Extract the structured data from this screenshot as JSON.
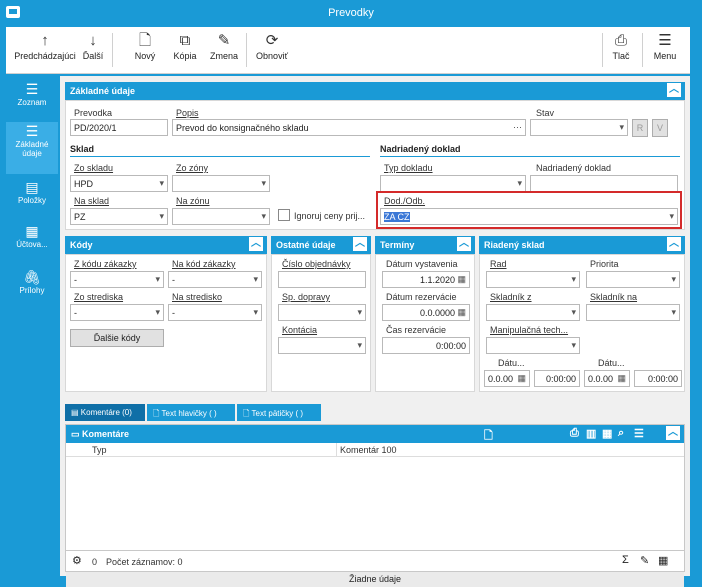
{
  "window": {
    "title": "Prevodky"
  },
  "ribbon": {
    "prev": "Predchádzajúci",
    "next": "Ďalší",
    "new": "Nový",
    "copy": "Kópia",
    "change": "Zmena",
    "refresh": "Obnoviť",
    "print": "Tlač",
    "menu": "Menu"
  },
  "sidebar": {
    "items": [
      {
        "label": "Zoznam"
      },
      {
        "label": "Základné údaje"
      },
      {
        "label": "Položky"
      },
      {
        "label": "Účtova..."
      },
      {
        "label": "Prílohy"
      }
    ]
  },
  "basic": {
    "header": "Základné údaje",
    "prevodka_label": "Prevodka",
    "prevodka_value": "PD/2020/1",
    "popis_label": "Popis",
    "popis_value": "Prevod do konsignačného skladu",
    "stav_label": "Stav",
    "stav_value": "",
    "r_btn": "R",
    "v_btn": "V"
  },
  "sklad": {
    "title": "Sklad",
    "zo_skladu_label": "Zo skladu",
    "zo_skladu_value": "HPD",
    "zo_zony_label": "Zo zóny",
    "zo_zony_value": "",
    "na_sklad_label": "Na sklad",
    "na_sklad_value": "PZ",
    "na_zonu_label": "Na zónu",
    "na_zonu_value": "",
    "ignoruj_label": "Ignoruj ceny prij..."
  },
  "nadriadeny": {
    "title": "Nadriadený doklad",
    "typ_label": "Typ dokladu",
    "typ_value": "",
    "doklad_label": "Nadriadený doklad",
    "doklad_value": "",
    "dod_label": "Dod./Odb.",
    "dod_value": "ZA CZ"
  },
  "kody": {
    "header": "Kódy",
    "z_kodu_label": "Z kódu zákazky",
    "z_kodu_value": "-",
    "na_kod_label": "Na kód zákazky",
    "na_kod_value": "-",
    "zo_strediska_label": "Zo strediska",
    "zo_strediska_value": "-",
    "na_stredisko_label": "Na stredisko",
    "na_stredisko_value": "-",
    "dalsie_btn": "Ďalšie kódy"
  },
  "ostatne": {
    "header": "Ostatné údaje",
    "cislo_label": "Číslo objednávky",
    "cislo_value": "",
    "sp_label": "Sp. dopravy",
    "sp_value": "",
    "kontacia_label": "Kontácia",
    "kontacia_value": ""
  },
  "terminy": {
    "header": "Termíny",
    "datum_vyst_label": "Dátum vystavenia",
    "datum_vyst_value": "1.1.2020",
    "datum_rez_label": "Dátum rezervácie",
    "datum_rez_value": "0.0.0000",
    "cas_rez_label": "Čas rezervácie",
    "cas_rez_value": "0:00:00"
  },
  "riadeny": {
    "header": "Riadený sklad",
    "rad_label": "Rad",
    "rad_value": "",
    "priorita_label": "Priorita",
    "priorita_value": "",
    "skladnik_z_label": "Skladník z",
    "skladnik_z_value": "",
    "skladnik_na_label": "Skladník na",
    "skladnik_na_value": "",
    "manip_label": "Manipulačná tech...",
    "manip_value": "",
    "datu1_label": "Dátu...",
    "datu1_value": "0.0.00",
    "time1_value": "0:00:00",
    "datu2_label": "Dátu...",
    "datu2_value": "0.0.00",
    "time2_value": "0:00:00"
  },
  "tabs": [
    {
      "label": "Komentáre (0)"
    },
    {
      "label": "Text hlavičky ( )"
    },
    {
      "label": "Text pätičky ( )"
    }
  ],
  "grid": {
    "header": "Komentáre",
    "col1": "Typ",
    "col2": "Komentár 100",
    "empty": "Žiadne údaje",
    "footer_count": "0",
    "footer_label": "Počet záznamov: 0"
  },
  "colors": {
    "accent": "#1a9ad6",
    "highlight_border": "#d42a2a"
  }
}
